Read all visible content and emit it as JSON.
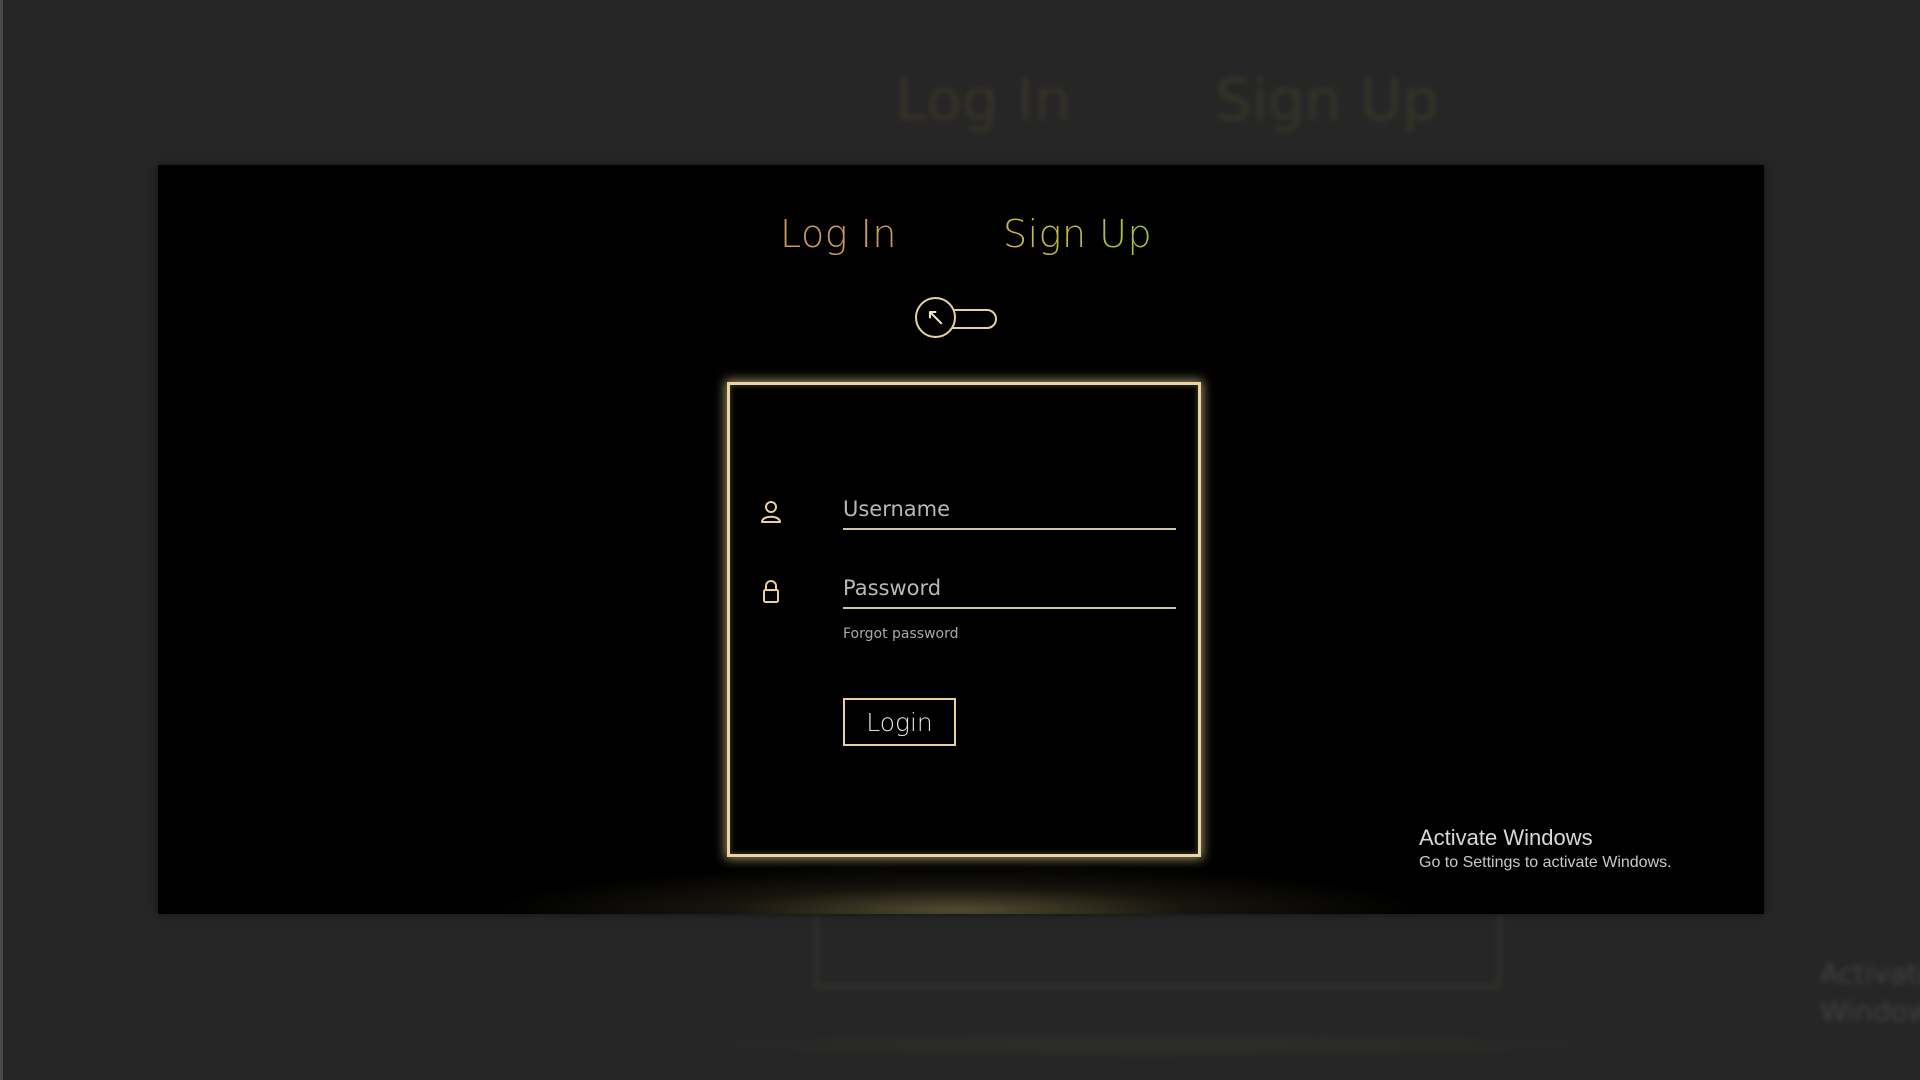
{
  "tabs": {
    "login": "Log In",
    "signup": "Sign Up"
  },
  "toggle": {
    "knob_glyph": "↖",
    "state": "login"
  },
  "form": {
    "username_placeholder": "Username",
    "password_placeholder": "Password",
    "forgot_label": "Forgot password",
    "login_button": "Login"
  },
  "watermark": {
    "title": "Activate Windows",
    "subtitle": "Go to Settings to activate Windows."
  },
  "icons": {
    "username": "user-icon",
    "password": "lock-icon"
  },
  "colors": {
    "accent_gold": "#e6d29e",
    "login_tab": "#c99a5e",
    "signup_tab_start": "#d2b24a",
    "signup_tab_end": "#9cc240",
    "panel_bg": "#000000",
    "page_bg": "#262626"
  }
}
